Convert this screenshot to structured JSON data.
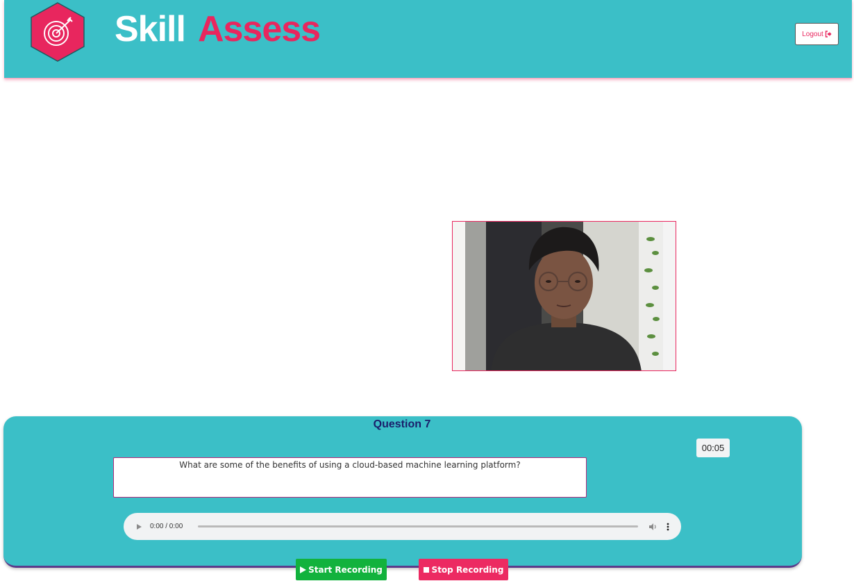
{
  "header": {
    "brand_word1": "Skill",
    "brand_word2": "Assess",
    "logout_label": "Logout",
    "logo_icon": "target-icon"
  },
  "colors": {
    "teal": "#3bbfc7",
    "accent": "#e8265e",
    "start_green": "#12b23d",
    "stop_pink": "#ec2a62",
    "title_navy": "#1a1f6b"
  },
  "question": {
    "title": "Question 7",
    "timer": "00:05",
    "text": "What are some of the benefits of using a cloud-based machine learning platform?"
  },
  "audio": {
    "time": "0:00 / 0:00"
  },
  "controls": {
    "start_label": "Start Recording",
    "stop_label": "Stop Recording"
  }
}
